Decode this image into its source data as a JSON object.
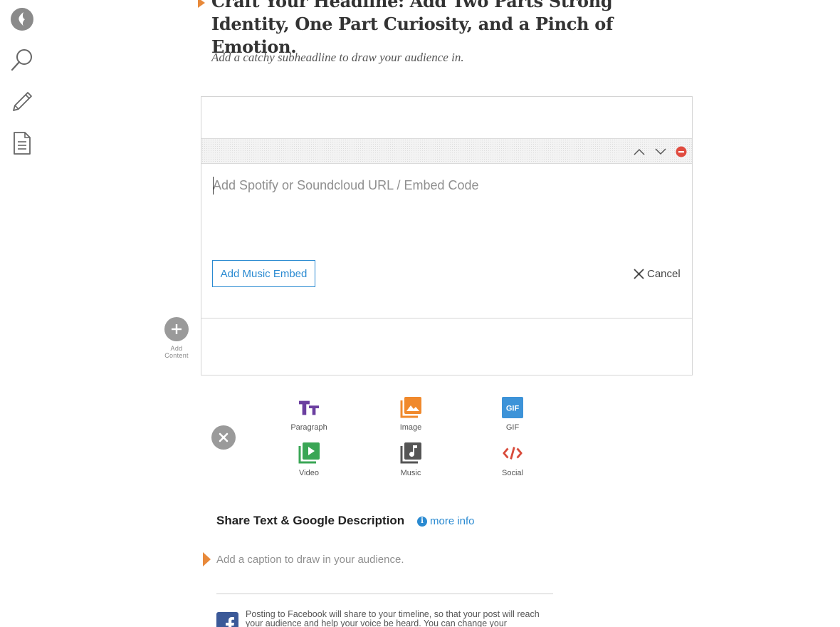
{
  "rail": {
    "items": [
      {
        "name": "logo-icon"
      },
      {
        "name": "search-icon"
      },
      {
        "name": "pencil-icon"
      },
      {
        "name": "document-icon"
      }
    ]
  },
  "story": {
    "headline": "Craft Your Headline: Add Two Parts Strong Identity, One Part Curiosity, and a Pinch of Emotion.",
    "subheadline": "Add a catchy subheadline to draw your audience in."
  },
  "music_block": {
    "input_placeholder": "Add Spotify or Soundcloud URL / Embed Code",
    "input_value": "",
    "add_button_label": "Add Music Embed",
    "cancel_label": "Cancel"
  },
  "add_content": {
    "label_line1": "Add",
    "label_line2": "Content"
  },
  "content_types": [
    {
      "label": "Paragraph",
      "icon": "paragraph-icon"
    },
    {
      "label": "Image",
      "icon": "image-icon"
    },
    {
      "label": "GIF",
      "icon": "gif-icon"
    },
    {
      "label": "Video",
      "icon": "video-icon"
    },
    {
      "label": "Music",
      "icon": "music-icon"
    },
    {
      "label": "Social",
      "icon": "social-icon"
    }
  ],
  "share": {
    "title": "Share Text & Google Description",
    "more_info": "more info",
    "caption_placeholder": "Add a caption to draw in your audience.",
    "facebook_notice": "Posting to Facebook will share to your timeline, so that your post will reach your audience and help your voice be heard. You can change your"
  },
  "colors": {
    "accent_blue": "#2a8ad1",
    "caret_orange": "#e8893a",
    "remove_red": "#e04b3f",
    "paragraph_purple": "#6b3fa0",
    "image_orange": "#f0892c",
    "gif_blue": "#3d93d8",
    "video_green": "#3aa655",
    "music_dark": "#555555",
    "social_red": "#d84a3a",
    "facebook_blue": "#3b5998"
  }
}
